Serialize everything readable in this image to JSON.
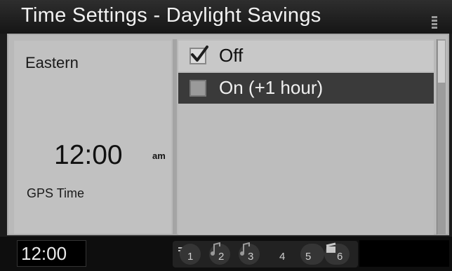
{
  "header": {
    "title": "Time Settings - Daylight Savings"
  },
  "left_panel": {
    "region": "Eastern",
    "time": "12:00",
    "ampm": "am",
    "source": "GPS Time"
  },
  "options": [
    {
      "label": "Off",
      "checked": true,
      "highlighted": false
    },
    {
      "label": "On (+1 hour)",
      "checked": false,
      "highlighted": true
    }
  ],
  "status_bar": {
    "clock": "12:00",
    "presets": [
      "1",
      "2",
      "3",
      "4",
      "5",
      "6"
    ]
  },
  "colors": {
    "highlight": "#3a3a3a",
    "panel": "#c1c1c1",
    "titlebar": "#1c1c1c"
  }
}
